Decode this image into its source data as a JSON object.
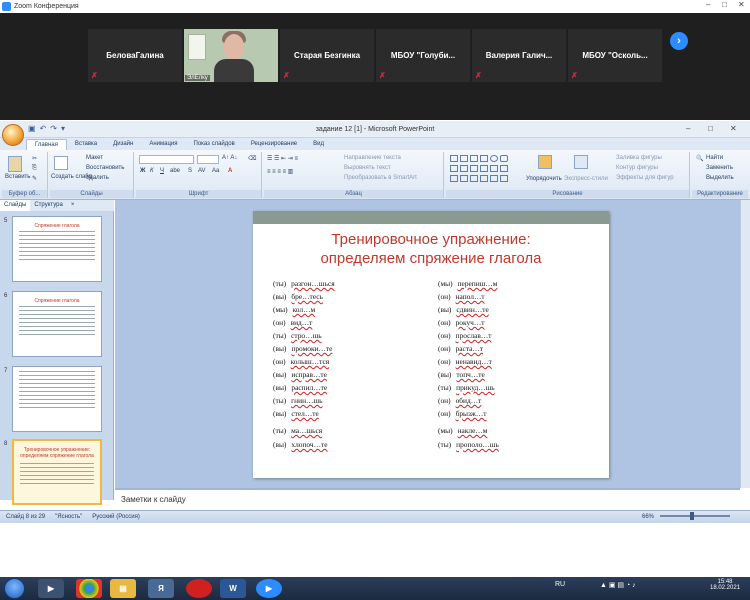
{
  "zoom": {
    "window_title": "Zoom Конференция",
    "participants": [
      {
        "name": "БеловаГалина",
        "muted": true
      },
      {
        "name": "ЭлЕлку",
        "muted": true,
        "video": true
      },
      {
        "name": "Старая Безгинка",
        "muted": true
      },
      {
        "name": "МБОУ \"Голуби...",
        "muted": true
      },
      {
        "name": "Валерия Галич...",
        "muted": true
      },
      {
        "name": "МБОУ \"Осколь...",
        "muted": true
      }
    ],
    "next_symbol": "›"
  },
  "ppt": {
    "window_title": "задание 12 [1] - Microsoft PowerPoint",
    "tabs": [
      "Главная",
      "Вставка",
      "Дизайн",
      "Анимация",
      "Показ слайдов",
      "Рецензирование",
      "Вид"
    ],
    "active_tab": "Главная",
    "ribbon": {
      "clipboard": {
        "label": "Буфер об...",
        "paste": "Вставить",
        "cut": "Вырезать",
        "copy": "Копировать"
      },
      "slides": {
        "label": "Слайды",
        "new_slide": "Создать слайд",
        "layout": "Макет",
        "reset": "Восстановить",
        "delete": "Удалить"
      },
      "font": {
        "label": "Шрифт"
      },
      "paragraph": {
        "label": "Абзац",
        "text_direction": "Направление текста",
        "align_text": "Выровнять текст",
        "smartart": "Преобразовать в SmartArt"
      },
      "drawing": {
        "label": "Рисование",
        "arrange": "Упорядочить",
        "quick_styles": "Экспресс-стили",
        "fill": "Заливка фигуры",
        "outline": "Контур фигуры",
        "effects": "Эффекты для фигур"
      },
      "editing": {
        "label": "Редактирование",
        "find": "Найти",
        "replace": "Заменить",
        "select": "Выделить"
      }
    },
    "pane_tabs": [
      "Слайды",
      "Структура"
    ],
    "thumbnails": [
      {
        "number": "5",
        "title": "Спряжение глагола"
      },
      {
        "number": "6",
        "title": "Спряжение глагола"
      },
      {
        "number": "7",
        "title": ""
      },
      {
        "number": "8",
        "title": "Тренировочное упражнение: определяем спряжение глагола",
        "selected": true
      }
    ],
    "slide": {
      "title_line1": "Тренировочное упражнение:",
      "title_line2": "определяем спряжение глагола",
      "left_column": [
        {
          "pronoun": "(ты)",
          "word": "разгон…шься"
        },
        {
          "pronoun": "(вы)",
          "word": "бре…тесь"
        },
        {
          "pronoun": "(мы)",
          "word": "кол…м"
        },
        {
          "pronoun": "(он)",
          "word": "вид…т"
        },
        {
          "pronoun": "(ты)",
          "word": "стро…шь"
        },
        {
          "pronoun": "(вы)",
          "word": "промоки…те"
        },
        {
          "pronoun": "(он)",
          "word": "колыш…тся"
        },
        {
          "pronoun": "(вы)",
          "word": "исправ…те"
        },
        {
          "pronoun": "(вы)",
          "word": "распил…те"
        },
        {
          "pronoun": "(ты)",
          "word": "гнин…шь"
        },
        {
          "pronoun": "(вы)",
          "word": "стел…те"
        },
        {
          "pronoun": "(ты)",
          "word": "ма…шься"
        },
        {
          "pronoun": "(вы)",
          "word": "хлопоч…те"
        }
      ],
      "right_column": [
        {
          "pronoun": "(мы)",
          "word": "перепиш…м"
        },
        {
          "pronoun": "(он)",
          "word": "напол…т"
        },
        {
          "pronoun": "(вы)",
          "word": "сдвин…те"
        },
        {
          "pronoun": "(он)",
          "word": "рокуч…т"
        },
        {
          "pronoun": "(он)",
          "word": "прослав…т"
        },
        {
          "pronoun": "(он)",
          "word": "раста…т"
        },
        {
          "pronoun": "(он)",
          "word": "ненавид…т"
        },
        {
          "pronoun": "(вы)",
          "word": "топч…те"
        },
        {
          "pronoun": "(ты)",
          "word": "прикуд…шь"
        },
        {
          "pronoun": "(он)",
          "word": "обид…т"
        },
        {
          "pronoun": "(он)",
          "word": "брызж…т"
        },
        {
          "pronoun": "(мы)",
          "word": "накле…м"
        },
        {
          "pronoun": "(ты)",
          "word": "прополо…шь"
        }
      ]
    },
    "notes_placeholder": "Заметки к слайду",
    "status": {
      "slide": "Слайд 8 из 29",
      "theme": "\"Ясность\"",
      "language": "Русский (Россия)",
      "zoom": "66%"
    }
  },
  "taskbar": {
    "apps": [
      "media-player",
      "chrome",
      "explorer",
      "yandex",
      "word",
      "zoom"
    ],
    "lang": "RU",
    "time": "15:48",
    "date": "18.02.2021"
  }
}
